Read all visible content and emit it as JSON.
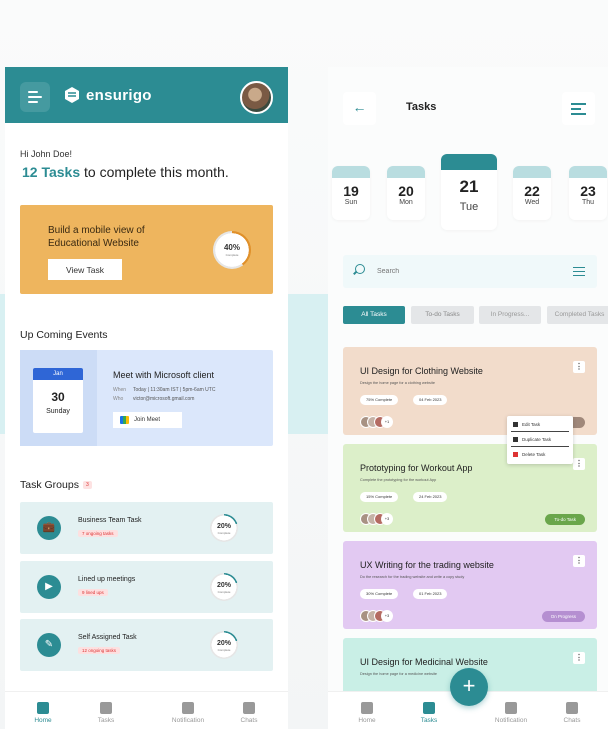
{
  "left": {
    "logo_text": "ensurigo",
    "greeting": "Hi John Doe!",
    "tasks_count": "12 Tasks",
    "tasks_suffix": " to complete this month.",
    "promo": {
      "title": "Build a mobile view of Educational Website",
      "button": "View Task",
      "progress_label": "40%",
      "progress_caption": "Complete",
      "progress": 0.4
    },
    "events_title": "Up Coming Events",
    "event": {
      "month": "Jan",
      "day": "30",
      "weekday": "Sunday",
      "title": "Meet with  Microsoft client",
      "when_label": "When",
      "when": "Today | 11:30am IST | 5pm-6am UTC",
      "who_label": "Who",
      "who": "victor@microsoft.gmail.com",
      "join": "Join Meet"
    },
    "groups_title": "Task Groups",
    "groups_count": "3",
    "groups": [
      {
        "title": "Business Team Task",
        "sub": "7 ongoing tasks",
        "pct": "20%",
        "caption": "Complete",
        "progress": 0.2
      },
      {
        "title": "Lined up meetings",
        "sub": "9 lined ups",
        "pct": "20%",
        "caption": "Complete",
        "progress": 0.2
      },
      {
        "title": "Self Assigned Task",
        "sub": "12 ongoing tasks",
        "pct": "20%",
        "caption": "Complete",
        "progress": 0.2
      }
    ],
    "nav": [
      "Home",
      "Tasks",
      "Notification",
      "Chats"
    ]
  },
  "right": {
    "title": "Tasks",
    "days": [
      {
        "num": "19",
        "name": "Sun"
      },
      {
        "num": "20",
        "name": "Mon"
      },
      {
        "num": "21",
        "name": "Tue"
      },
      {
        "num": "22",
        "name": "Wed"
      },
      {
        "num": "23",
        "name": "Thu"
      }
    ],
    "search_placeholder": "Search",
    "tabs": [
      "All Tasks",
      "To-do Tasks",
      "In Progress...",
      "Completed Tasks"
    ],
    "cards": [
      {
        "title": "UI Design for Clothing Website",
        "desc": "Design the  home page for a clothing website",
        "complete": "75% Complete",
        "date": "04 Feb 2023",
        "more": "+1",
        "status": "",
        "color": "#f2dccb"
      },
      {
        "title": "Prototyping for Workout App",
        "desc": "Complete the prototyping for the workout App",
        "complete": "15% Complete",
        "date": "24 Feb 2023",
        "more": "+3",
        "status": "To-do Task",
        "color": "#dcefc9"
      },
      {
        "title": "UX Writing for the trading website",
        "desc": "Do the research for the trading website and write a copy study",
        "complete": "30% Complete",
        "date": "01 Feb 2023",
        "more": "+3",
        "status": "On Progress",
        "color": "#e2c9f2"
      },
      {
        "title": "UI Design for Medicinal Website",
        "desc": "Design the  home page for a medicine website",
        "complete": "",
        "date": "",
        "more": "",
        "status": "",
        "color": "#c9efe6"
      }
    ],
    "menu": [
      "Edit Task",
      "Duplicate Task",
      "Delete Task"
    ],
    "nav": [
      "Home",
      "Tasks",
      "Notification",
      "Chats"
    ]
  },
  "colors": {
    "primary": "#2c8c93",
    "promo": "#eeb55e",
    "event": "#dbe7fb",
    "group": "#e3f1f2"
  }
}
